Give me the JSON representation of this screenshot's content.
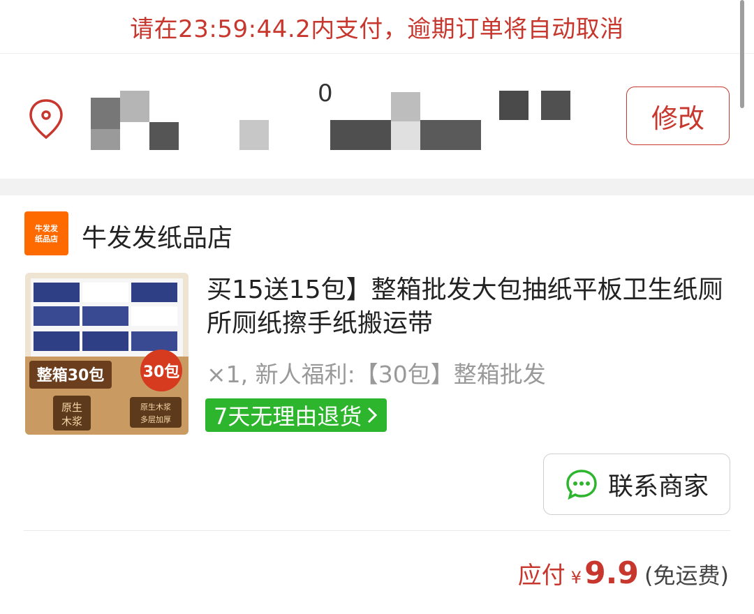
{
  "countdown": {
    "text": "请在23:59:44.2内支付，逾期订单将自动取消"
  },
  "address": {
    "icon": "location-pin-icon",
    "edit_label": "修改"
  },
  "store": {
    "logo_line1": "牛发发",
    "logo_line2": "纸品店",
    "name": "牛发发纸品店"
  },
  "product": {
    "image_badges": {
      "box_label": "整箱30包",
      "count_badge": "30包",
      "pulp_label": "原生木浆",
      "thick_label": "原生木浆 多层加厚"
    },
    "title": "买15送15包】整箱批发大包抽纸平板卫生纸厕所厕纸擦手纸搬运带",
    "spec": "×1, 新人福利:【30包】整箱批发",
    "return_badge": "7天无理由退货"
  },
  "contact": {
    "label": "联系商家",
    "icon": "chat-bubble-icon"
  },
  "payment": {
    "label": "应付",
    "currency": "¥",
    "amount": "9.9",
    "note": "(免运费)"
  },
  "colors": {
    "accent": "#c8372d",
    "store_logo": "#ff6a00",
    "return_badge": "#2db52d"
  }
}
